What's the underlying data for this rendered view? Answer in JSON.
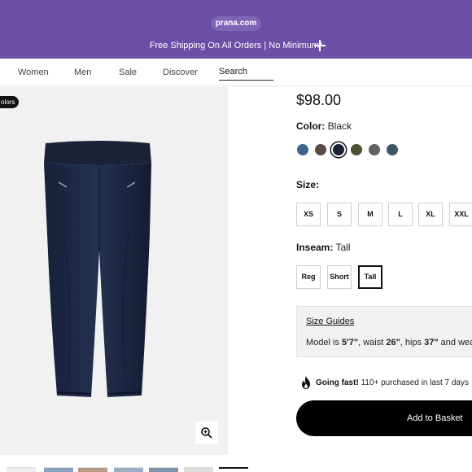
{
  "banner": {
    "brand": "prana.com",
    "promo_text": "Free Shipping On All Orders | No Minimum*",
    "background_color": "#6b4fa6",
    "expand_icon": "plus-icon"
  },
  "nav": {
    "items": [
      "Women",
      "Men",
      "Sale",
      "Discover"
    ],
    "search_label": "Search"
  },
  "gallery": {
    "colors_badge": "olors",
    "zoom_icon": "zoom-in-icon",
    "image_subject": "black-pants"
  },
  "product": {
    "price": "$98.00",
    "color_label": "Color:",
    "color_value": "Black",
    "swatches": [
      {
        "name": "blue",
        "hex": "#3e6590"
      },
      {
        "name": "brown",
        "hex": "#5a4a44"
      },
      {
        "name": "black",
        "hex": "#1c2233",
        "selected": true
      },
      {
        "name": "olive",
        "hex": "#4f5133"
      },
      {
        "name": "gray",
        "hex": "#5f6462"
      },
      {
        "name": "slate",
        "hex": "#3d5766"
      }
    ],
    "size_label": "Size:",
    "sizes": [
      "XS",
      "S",
      "M",
      "L",
      "XL",
      "XXL"
    ],
    "inseam_label": "Inseam:",
    "inseam_value": "Tall",
    "inseams": [
      "Reg",
      "Short",
      "Tall"
    ],
    "selected_inseam": "Tall"
  },
  "size_guide": {
    "link": "Size Guides",
    "model_prefix": "Model is ",
    "height": "5'7\"",
    "waist_prefix": ", waist ",
    "waist": "26\"",
    "hips_prefix": ", hips ",
    "hips": "37\"",
    "suffix": " and weari"
  },
  "urgency": {
    "icon": "flame-icon",
    "bold": "Going fast!",
    "text": "110+ purchased in last 7 days"
  },
  "cta": {
    "add_to_basket": "Add to Basket"
  }
}
